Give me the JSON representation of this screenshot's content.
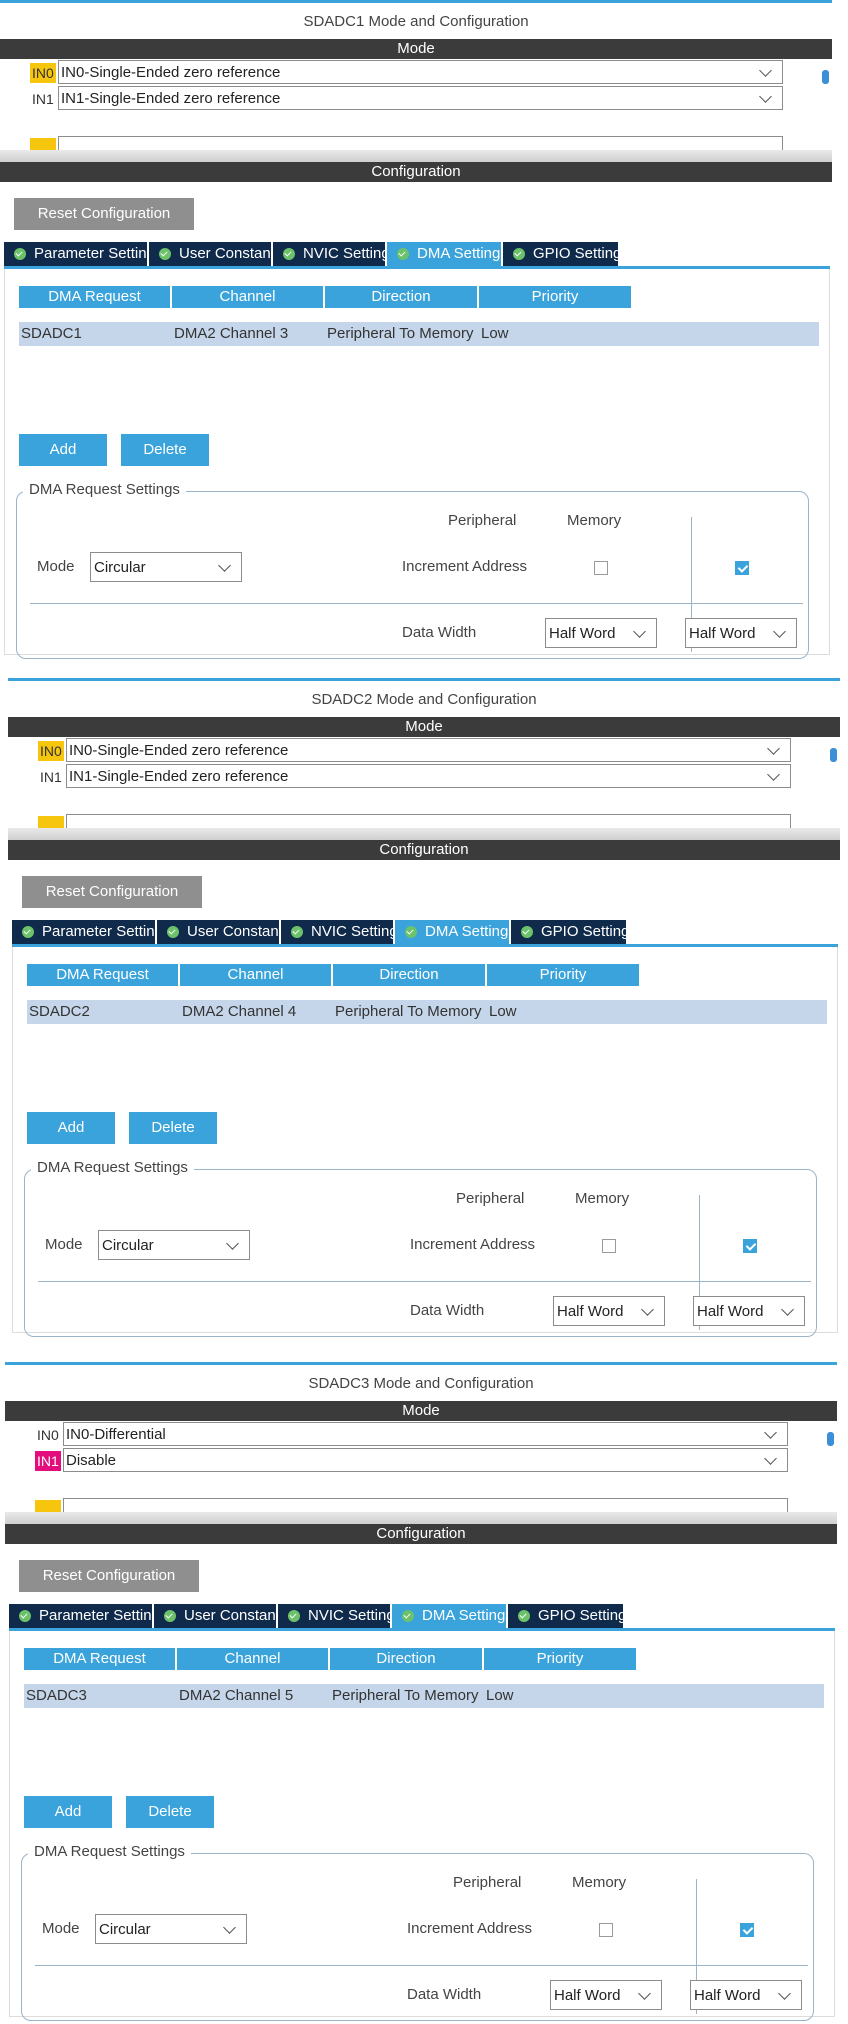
{
  "panels": [
    {
      "title": "SDADC1 Mode and Configuration",
      "mode_label": "Mode",
      "config_label": "Configuration",
      "pins": [
        {
          "label": "IN0",
          "value": "IN0-Single-Ended zero reference",
          "highlight": "yellow"
        },
        {
          "label": "IN1",
          "value": "IN1-Single-Ended zero reference",
          "highlight": "none"
        }
      ],
      "reset_label": "Reset Configuration",
      "tabs": [
        "Parameter Settings",
        "User Constants",
        "NVIC Settings",
        "DMA Settings",
        "GPIO Settings"
      ],
      "active_tab": "DMA Settings",
      "table_headers": [
        "DMA Request",
        "Channel",
        "Direction",
        "Priority"
      ],
      "table_row": [
        "SDADC1",
        "DMA2 Channel 3",
        "Peripheral To Memory",
        "Low"
      ],
      "add_label": "Add",
      "delete_label": "Delete",
      "settings_legend": "DMA Request Settings",
      "peripheral_label": "Peripheral",
      "memory_label": "Memory",
      "mode_field_label": "Mode",
      "mode_value": "Circular",
      "increment_label": "Increment Address",
      "peripheral_increment": false,
      "memory_increment": true,
      "data_width_label": "Data Width",
      "peripheral_width": "Half Word",
      "memory_width": "Half Word"
    },
    {
      "title": "SDADC2 Mode and Configuration",
      "mode_label": "Mode",
      "config_label": "Configuration",
      "pins": [
        {
          "label": "IN0",
          "value": "IN0-Single-Ended zero reference",
          "highlight": "yellow"
        },
        {
          "label": "IN1",
          "value": "IN1-Single-Ended zero reference",
          "highlight": "none"
        }
      ],
      "reset_label": "Reset Configuration",
      "tabs": [
        "Parameter Settings",
        "User Constants",
        "NVIC Settings",
        "DMA Settings",
        "GPIO Settings"
      ],
      "active_tab": "DMA Settings",
      "table_headers": [
        "DMA Request",
        "Channel",
        "Direction",
        "Priority"
      ],
      "table_row": [
        "SDADC2",
        "DMA2 Channel 4",
        "Peripheral To Memory",
        "Low"
      ],
      "add_label": "Add",
      "delete_label": "Delete",
      "settings_legend": "DMA Request Settings",
      "peripheral_label": "Peripheral",
      "memory_label": "Memory",
      "mode_field_label": "Mode",
      "mode_value": "Circular",
      "increment_label": "Increment Address",
      "peripheral_increment": false,
      "memory_increment": true,
      "data_width_label": "Data Width",
      "peripheral_width": "Half Word",
      "memory_width": "Half Word"
    },
    {
      "title": "SDADC3 Mode and Configuration",
      "mode_label": "Mode",
      "config_label": "Configuration",
      "pins": [
        {
          "label": "IN0",
          "value": "IN0-Differential",
          "highlight": "none"
        },
        {
          "label": "IN1",
          "value": "Disable",
          "highlight": "pink"
        }
      ],
      "reset_label": "Reset Configuration",
      "tabs": [
        "Parameter Settings",
        "User Constants",
        "NVIC Settings",
        "DMA Settings",
        "GPIO Settings"
      ],
      "active_tab": "DMA Settings",
      "table_headers": [
        "DMA Request",
        "Channel",
        "Direction",
        "Priority"
      ],
      "table_row": [
        "SDADC3",
        "DMA2 Channel 5",
        "Peripheral To Memory",
        "Low"
      ],
      "add_label": "Add",
      "delete_label": "Delete",
      "settings_legend": "DMA Request Settings",
      "peripheral_label": "Peripheral",
      "memory_label": "Memory",
      "mode_field_label": "Mode",
      "mode_value": "Circular",
      "increment_label": "Increment Address",
      "peripheral_increment": false,
      "memory_increment": true,
      "data_width_label": "Data Width",
      "peripheral_width": "Half Word",
      "memory_width": "Half Word"
    }
  ],
  "colors": {
    "accent": "#3aa3dc",
    "tab_bar": "#0f2a4a",
    "header_bar": "#3b3b3b",
    "row_highlight": "#c5d6ea",
    "pin_yellow": "#f6c50e",
    "pin_pink": "#e30e7b"
  }
}
